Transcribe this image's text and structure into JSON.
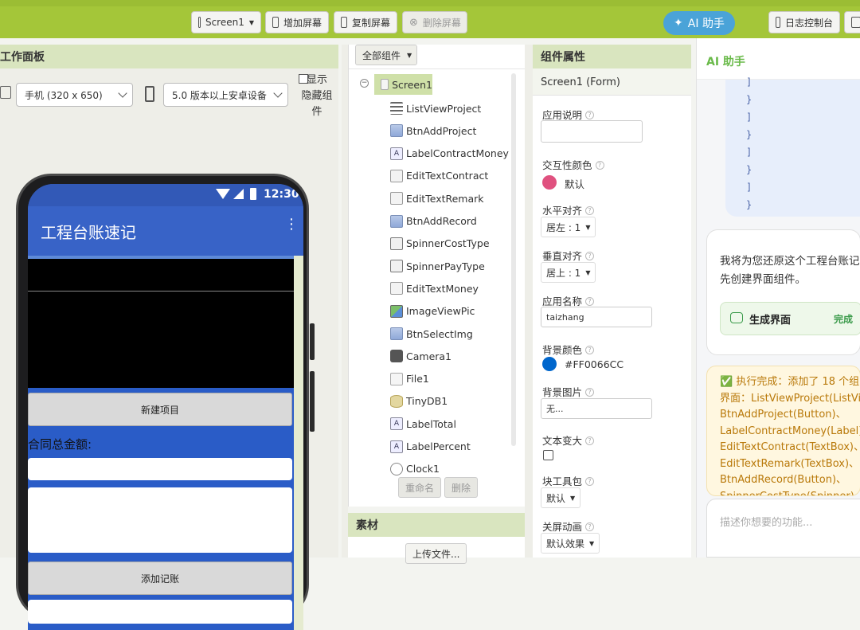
{
  "toolbar": {
    "screen_select": "Screen1",
    "add_screen": "增加屏幕",
    "copy_screen": "复制屏幕",
    "delete_screen": "删除屏幕",
    "ai_assistant": "AI 助手",
    "log_console": "日志控制台"
  },
  "work_panel": {
    "title": "工作面板",
    "device_size": "手机 (320 x 650)",
    "android_version": "5.0 版本以上安卓设备",
    "show_hidden": "显示\n隐藏组\n件"
  },
  "phone": {
    "time": "12:30",
    "app_title": "工程台账速记",
    "btn_new_project": "新建项目",
    "label_contract_total": "合同总金额:",
    "btn_add_record": "添加记账"
  },
  "components": {
    "filter": "全部组件",
    "root": "Screen1",
    "items": [
      {
        "name": "ListViewProject",
        "icon": "list-icon"
      },
      {
        "name": "BtnAddProject",
        "icon": "button-icon"
      },
      {
        "name": "LabelContractMoney",
        "icon": "label-icon"
      },
      {
        "name": "EditTextContract",
        "icon": "textbox-icon"
      },
      {
        "name": "EditTextRemark",
        "icon": "textbox-icon"
      },
      {
        "name": "BtnAddRecord",
        "icon": "button-icon"
      },
      {
        "name": "SpinnerCostType",
        "icon": "spinner-icon"
      },
      {
        "name": "SpinnerPayType",
        "icon": "spinner-icon"
      },
      {
        "name": "EditTextMoney",
        "icon": "textbox-icon"
      },
      {
        "name": "ImageViewPic",
        "icon": "image-icon"
      },
      {
        "name": "BtnSelectImg",
        "icon": "button-icon"
      },
      {
        "name": "Camera1",
        "icon": "camera-icon"
      },
      {
        "name": "File1",
        "icon": "file-icon"
      },
      {
        "name": "TinyDB1",
        "icon": "database-icon"
      },
      {
        "name": "LabelTotal",
        "icon": "label-icon"
      },
      {
        "name": "LabelPercent",
        "icon": "label-icon"
      },
      {
        "name": "Clock1",
        "icon": "clock-icon"
      }
    ],
    "rename": "重命名",
    "delete": "删除"
  },
  "media": {
    "title": "素材",
    "upload": "上传文件..."
  },
  "properties": {
    "title": "组件属性",
    "subject": "Screen1 (Form)",
    "app_desc_label": "应用说明",
    "accent_color_label": "交互性颜色",
    "accent_color_value": "默认",
    "accent_color_hex": "#e0517f",
    "align_h_label": "水平对齐",
    "align_h_value": "居左 : 1",
    "align_v_label": "垂直对齐",
    "align_v_value": "居上 : 1",
    "app_name_label": "应用名称",
    "app_name_value": "taizhang",
    "bg_color_label": "背景颜色",
    "bg_color_value": "#FF0066CC",
    "bg_color_hex": "#0066cc",
    "bg_image_label": "背景图片",
    "bg_image_value": "无...",
    "big_text_label": "文本变大",
    "blocks_toolkit_label": "块工具包",
    "blocks_toolkit_value": "默认",
    "close_anim_label": "关屏动画",
    "close_anim_value": "默认效果"
  },
  "ai": {
    "title": "AI 助手",
    "code_lines": [
      "]",
      "}",
      "]",
      "}",
      "]",
      "}",
      "]",
      "}"
    ],
    "message": "我将为您还原这个工程台账记\n先创建界面组件。",
    "task_label": "生成界面",
    "task_status": "完成",
    "result": "✅ 执行完成：添加了 18 个组\n界面：ListViewProject(ListVie\nBtnAddProject(Button)、\nLabelContractMoney(Label)、\nEditTextContract(TextBox)、\nEditTextRemark(TextBox)、\nBtnAddRecord(Button)、\nSpinnerCostType(Spinner)、",
    "input_placeholder": "描述你想要的功能..."
  }
}
